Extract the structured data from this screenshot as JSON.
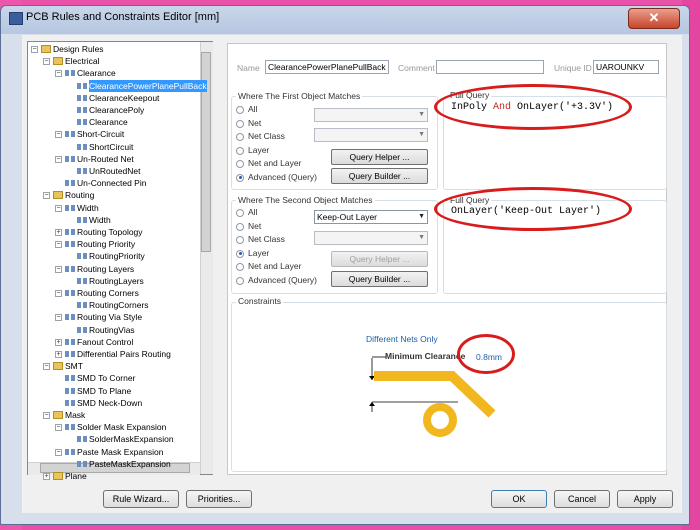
{
  "window": {
    "title": "PCB Rules and Constraints Editor [mm]",
    "close_glyph": "✕"
  },
  "tree": {
    "nodes": [
      {
        "label": "Design Rules"
      },
      {
        "label": "Electrical"
      },
      {
        "label": "Clearance"
      },
      {
        "label": "ClearancePowerPlanePullBack"
      },
      {
        "label": "ClearanceKeepout"
      },
      {
        "label": "ClearancePoly"
      },
      {
        "label": "Clearance"
      },
      {
        "label": "Short-Circuit"
      },
      {
        "label": "ShortCircuit"
      },
      {
        "label": "Un-Routed Net"
      },
      {
        "label": "UnRoutedNet"
      },
      {
        "label": "Un-Connected Pin"
      },
      {
        "label": "Routing"
      },
      {
        "label": "Width"
      },
      {
        "label": "Width"
      },
      {
        "label": "Routing Topology"
      },
      {
        "label": "Routing Priority"
      },
      {
        "label": "RoutingPriority"
      },
      {
        "label": "Routing Layers"
      },
      {
        "label": "RoutingLayers"
      },
      {
        "label": "Routing Corners"
      },
      {
        "label": "RoutingCorners"
      },
      {
        "label": "Routing Via Style"
      },
      {
        "label": "RoutingVias"
      },
      {
        "label": "Fanout Control"
      },
      {
        "label": "Differential Pairs Routing"
      },
      {
        "label": "SMT"
      },
      {
        "label": "SMD To Corner"
      },
      {
        "label": "SMD To Plane"
      },
      {
        "label": "SMD Neck-Down"
      },
      {
        "label": "Mask"
      },
      {
        "label": "Solder Mask Expansion"
      },
      {
        "label": "SolderMaskExpansion"
      },
      {
        "label": "Paste Mask Expansion"
      },
      {
        "label": "PasteMaskExpansion"
      },
      {
        "label": "Plane"
      }
    ]
  },
  "rule": {
    "name_label": "Name",
    "name_value": "ClearancePowerPlanePullBack",
    "comment_label": "Comment",
    "comment_value": "",
    "uid_label": "Unique ID",
    "uid_value": "UAROUNKV"
  },
  "first": {
    "title": "Where The First Object Matches",
    "options": [
      "All",
      "Net",
      "Net Class",
      "Layer",
      "Net and Layer",
      "Advanced (Query)"
    ],
    "selected": "Advanced (Query)",
    "query_helper": "Query Helper ...",
    "query_builder": "Query Builder ...",
    "full_query_label": "Full Query",
    "query_parts": [
      "InPoly",
      " And ",
      "OnLayer('+3.3V')"
    ]
  },
  "second": {
    "title": "Where The Second Object Matches",
    "options": [
      "All",
      "Net",
      "Net Class",
      "Layer",
      "Net and Layer",
      "Advanced (Query)"
    ],
    "selected": "Layer",
    "layer_value": "Keep-Out Layer",
    "query_helper": "Query Helper ...",
    "query_builder": "Query Builder ...",
    "full_query_label": "Full Query",
    "query": "OnLayer('Keep-Out Layer')"
  },
  "constraints": {
    "title": "Constraints",
    "nets_label": "Different Nets Only",
    "min_clearance_label": "Minimum Clearance",
    "value": "0.8mm"
  },
  "footer": {
    "rule_wizard": "Rule Wizard...",
    "priorities": "Priorities...",
    "ok": "OK",
    "cancel": "Cancel",
    "apply": "Apply"
  },
  "colors": {
    "accent_red": "#d81c1c",
    "query_keyword": "#c0281e",
    "trace": "#f2b71e",
    "selection": "#3399ff"
  }
}
